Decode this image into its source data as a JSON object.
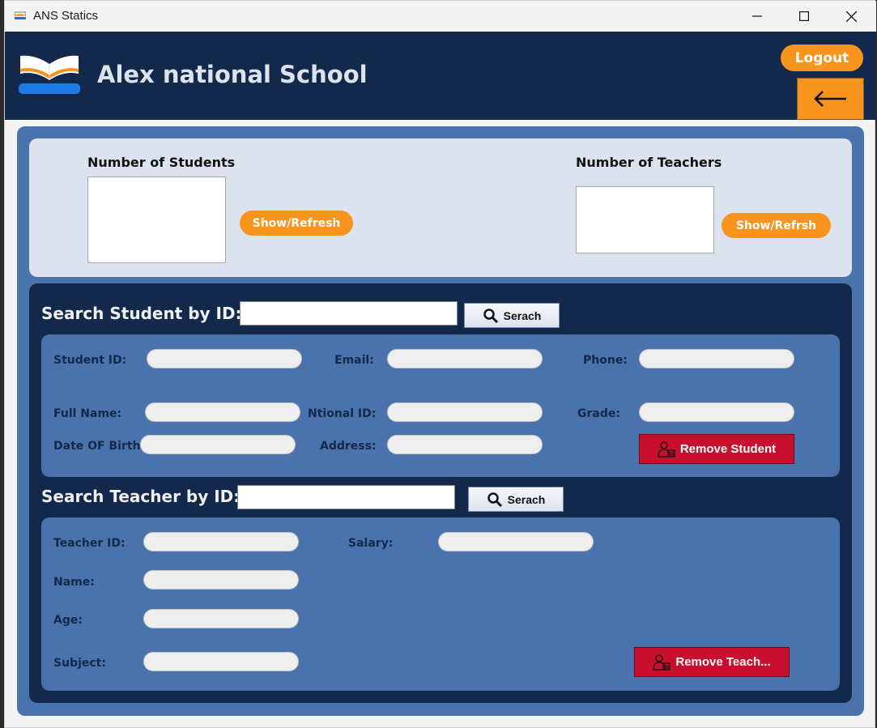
{
  "window": {
    "title": "ANS Statics"
  },
  "header": {
    "school_name": "Alex national School",
    "logout_label": "Logout"
  },
  "stats": {
    "students_label": "Number of Students",
    "teachers_label": "Number of Teachers",
    "students_button": "Show/Refresh",
    "teachers_button": "Show/Refrsh",
    "students_value": "",
    "teachers_value": ""
  },
  "student_search": {
    "label": "Search Student by ID:",
    "input_value": "",
    "button_label": "Serach",
    "fields": {
      "student_id": "Student ID:",
      "email": "Email:",
      "phone": "Phone:",
      "full_name": "Full Name:",
      "national_id": "Ntional ID:",
      "grade": "Grade:",
      "dob": "Date OF Birth:",
      "address": "Address:"
    },
    "remove_label": "Remove Student"
  },
  "teacher_search": {
    "label": "Search Teacher by ID:",
    "input_value": "",
    "button_label": "Serach",
    "fields": {
      "teacher_id": "Teacher ID:",
      "salary": "Salary:",
      "name": "Name:",
      "age": "Age:",
      "subject": "Subject:"
    },
    "remove_label": "Remove  Teach..."
  },
  "colors": {
    "navy": "#13294b",
    "panel_blue": "#4a72ad",
    "light_panel": "#dce3ee",
    "orange": "#f7941d",
    "danger": "#c8102e"
  },
  "icons": {
    "app": "book-icon",
    "back": "arrow-left-icon",
    "search": "magnifier-icon",
    "remove": "user-delete-icon"
  }
}
